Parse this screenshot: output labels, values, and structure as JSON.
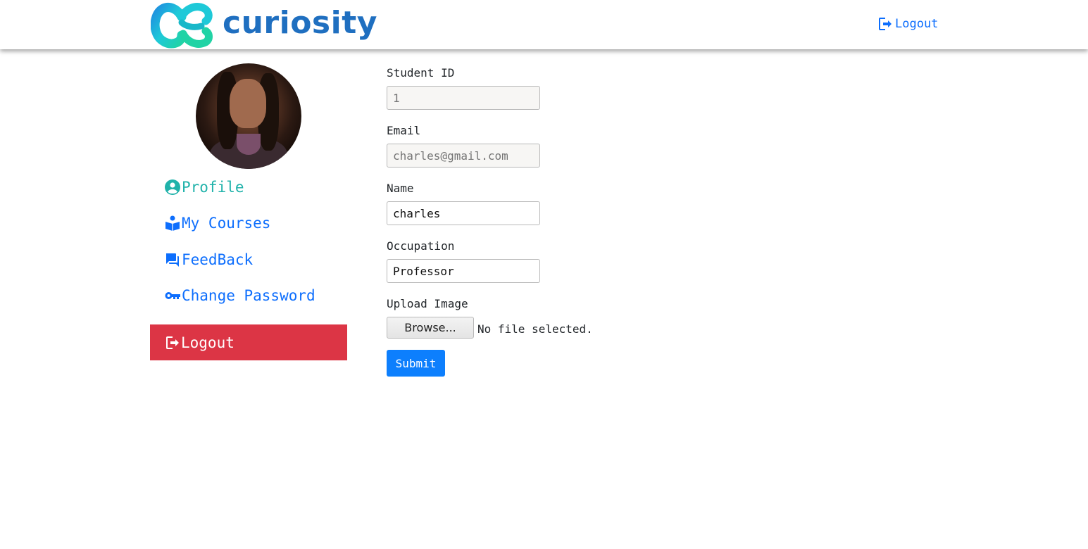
{
  "header": {
    "brand": "curiosity",
    "logout_label": "Logout"
  },
  "sidebar": {
    "items": [
      {
        "label": "Profile",
        "icon": "account-circle-icon",
        "active": true
      },
      {
        "label": "My Courses",
        "icon": "book-reader-icon",
        "active": false
      },
      {
        "label": "FeedBack",
        "icon": "forum-icon",
        "active": false
      },
      {
        "label": "Change Password",
        "icon": "key-icon",
        "active": false
      }
    ],
    "logout_label": "Logout"
  },
  "form": {
    "student_id": {
      "label": "Student ID",
      "placeholder": "1",
      "value": ""
    },
    "email": {
      "label": "Email",
      "placeholder": "charles@gmail.com",
      "value": ""
    },
    "name": {
      "label": "Name",
      "value": "charles"
    },
    "occupation": {
      "label": "Occupation",
      "value": "Professor"
    },
    "upload": {
      "label": "Upload Image",
      "button": "Browse...",
      "status": "No file selected."
    },
    "submit_label": "Submit"
  },
  "colors": {
    "primary": "#0d6efd",
    "active": "#20b2aa",
    "danger": "#dc3545",
    "brand_text": "#1f6fc0"
  }
}
